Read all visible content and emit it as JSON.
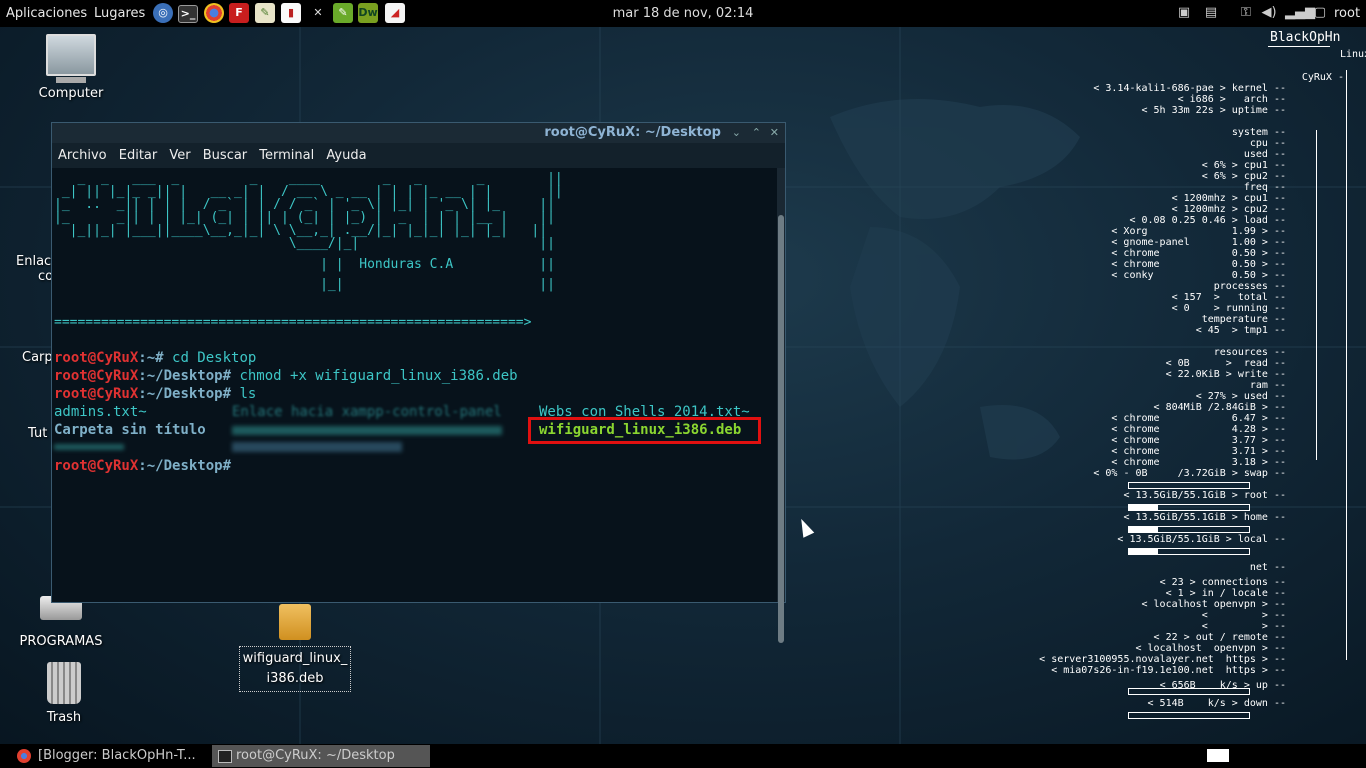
{
  "top_panel": {
    "applications": "Aplicaciones",
    "places": "Lugares",
    "launchers": [
      "browser-icon",
      "terminal-icon",
      "chrome-icon",
      "filezilla-icon",
      "gedit-icon",
      "settings-icon",
      "tools-icon",
      "leafpad-icon",
      "dreamweaver-icon",
      "pdf-icon"
    ],
    "clock": "mar 18 de nov, 02:14",
    "user": "root"
  },
  "desktop_icons": {
    "computer": "Computer",
    "partial_1a": "Enlac",
    "partial_1b": "co",
    "partial_2": "Carp",
    "partial_3": "Tut",
    "programas": "PROGRAMAS",
    "trash": "Trash",
    "deb_file_line1": "wifiguard_linux_",
    "deb_file_line2": "i386.deb"
  },
  "terminal": {
    "title": "root@CyRuX: ~/Desktop",
    "menu": [
      "Archivo",
      "Editar",
      "Ver",
      "Buscar",
      "Terminal",
      "Ayuda"
    ],
    "banner_lines": [
      "   _  _   ___  _         _    ____        _   _       _        ||",
      " _| || |_|_ _|| |   __ _| |  / __ \\ _ __ | | | |_ __ | |       ||",
      "|_  ..  _|| | | |  / _` | | / / _` | '_ \\| |_| | '_ \\| |_     ||",
      "|_      _|| | | |_| (_| | || | (_| | |_) |  _  | | | |__ |    ||",
      "  |_||_| |___||____\\__,_|_| \\ \\__,_| .__/|_| |_|_| |_| |_|   ||",
      "                              \\____/|_|                       ||",
      "                                  | |  Honduras C.A           ||",
      "                                  |_|                         ||",
      "============================================================>"
    ],
    "prompt_user": "root@CyRuX",
    "prompt_home": ":~#",
    "prompt_desktop": ":~/Desktop#",
    "cmd1": " cd Desktop",
    "cmd2": " chmod +x wifiguard_linux_i386.deb",
    "cmd3": " ls",
    "ls_col1": [
      "admins.txt~",
      "Carpeta sin título"
    ],
    "ls_col3": [
      "Webs con Shells 2014.txt~",
      "wifiguard_linux_i386.deb"
    ],
    "ls_blurred": "Enlace hacia xampp-control-panel",
    "highlight_color": "#e01010"
  },
  "conky": {
    "host": "BlackOpHn",
    "linux": "Linux",
    "lines": [
      "CyRuX -",
      "< 3.14-kali1-686-pae > kernel --",
      "< i686 >   arch --",
      "< 5h 33m 22s > uptime --",
      "system --",
      "cpu --",
      "used --",
      "< 6% > cpu1 --",
      "< 6% > cpu2 --",
      "freq --",
      "< 1200mhz > cpu1 --",
      "< 1200mhz > cpu2 --",
      "< 0.08 0.25 0.46 > load --",
      "< Xorg              1.99 > --",
      "< gnome-panel       1.00 > --",
      "< chrome            0.50 > --",
      "< chrome            0.50 > --",
      "< conky             0.50 > --",
      "processes --",
      "< 157  >   total --",
      "< 0    > running --",
      "temperature --",
      "< 45  > tmp1 --",
      "resources --",
      "< 0B      >  read --",
      "< 22.0KiB > write --",
      "ram --",
      "< 27% > used --",
      "< 804MiB /2.84GiB > --",
      "< chrome            6.47 > --",
      "< chrome            4.28 > --",
      "< chrome            3.77 > --",
      "< chrome            3.71 > --",
      "< chrome            3.18 > --",
      "< 0% - 0B     /3.72GiB > swap --",
      "< 13.5GiB/55.1GiB > root --",
      "< 13.5GiB/55.1GiB > home --",
      "< 13.5GiB/55.1GiB > local --",
      "net --",
      "< 23 > connections --",
      "< 1 > in / locale --",
      "< localhost openvpn > --",
      "<         > --",
      "<         > --",
      "< 22 > out / remote --",
      "< localhost  openvpn > --",
      "< server3100955.novalayer.net  https > --",
      "< mia07s26-in-f19.1e100.net  https > --",
      "< 656B    k/s > up --",
      "< 514B    k/s > down --"
    ],
    "bars": {
      "swap": 0.0,
      "root": 0.245,
      "home": 0.245,
      "local": 0.245
    }
  },
  "taskbar": {
    "item1": "[Blogger: BlackOpHn-T...",
    "item2": "root@CyRuX: ~/Desktop"
  }
}
